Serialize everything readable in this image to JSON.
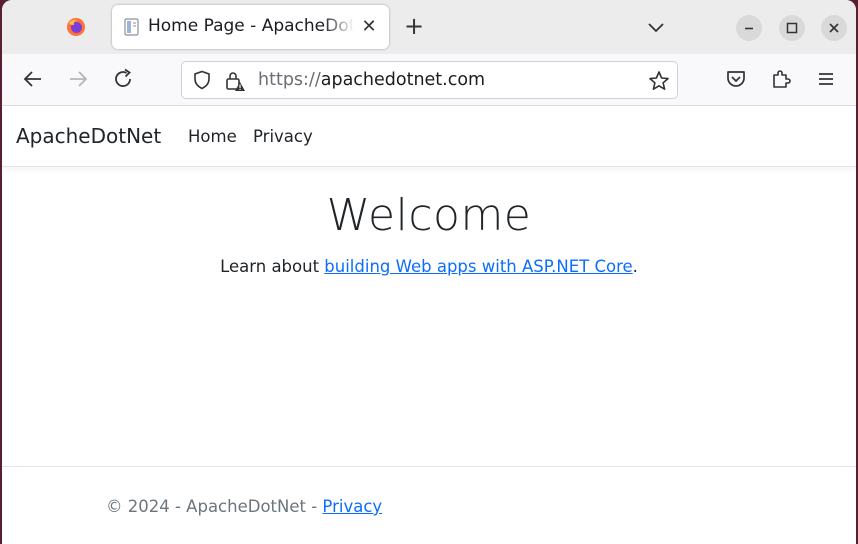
{
  "browser": {
    "tab": {
      "title": "Home Page - ApacheDotNet",
      "close_glyph": "✕"
    },
    "new_tab_glyph": "+",
    "url": {
      "scheme": "https://",
      "host": "apachedotnet.com"
    },
    "icons": {
      "app": "firefox-icon",
      "back": "back-arrow-icon",
      "forward": "forward-arrow-icon",
      "reload": "reload-icon",
      "shield": "shield-icon",
      "lock": "lock-warning-icon",
      "bookmark": "star-icon",
      "pocket": "pocket-icon",
      "extensions": "puzzle-icon",
      "menu": "hamburger-menu-icon"
    }
  },
  "site": {
    "brand": "ApacheDotNet",
    "nav": [
      {
        "label": "Home"
      },
      {
        "label": "Privacy"
      }
    ],
    "heading": "Welcome",
    "intro_prefix": "Learn about ",
    "intro_link": "building Web apps with ASP.NET Core",
    "intro_suffix": ".",
    "footer": {
      "text": "© 2024 - ApacheDotNet - ",
      "link": "Privacy"
    },
    "colors": {
      "link": "#0d6efd",
      "text": "#212529",
      "muted": "#6c757d"
    }
  }
}
